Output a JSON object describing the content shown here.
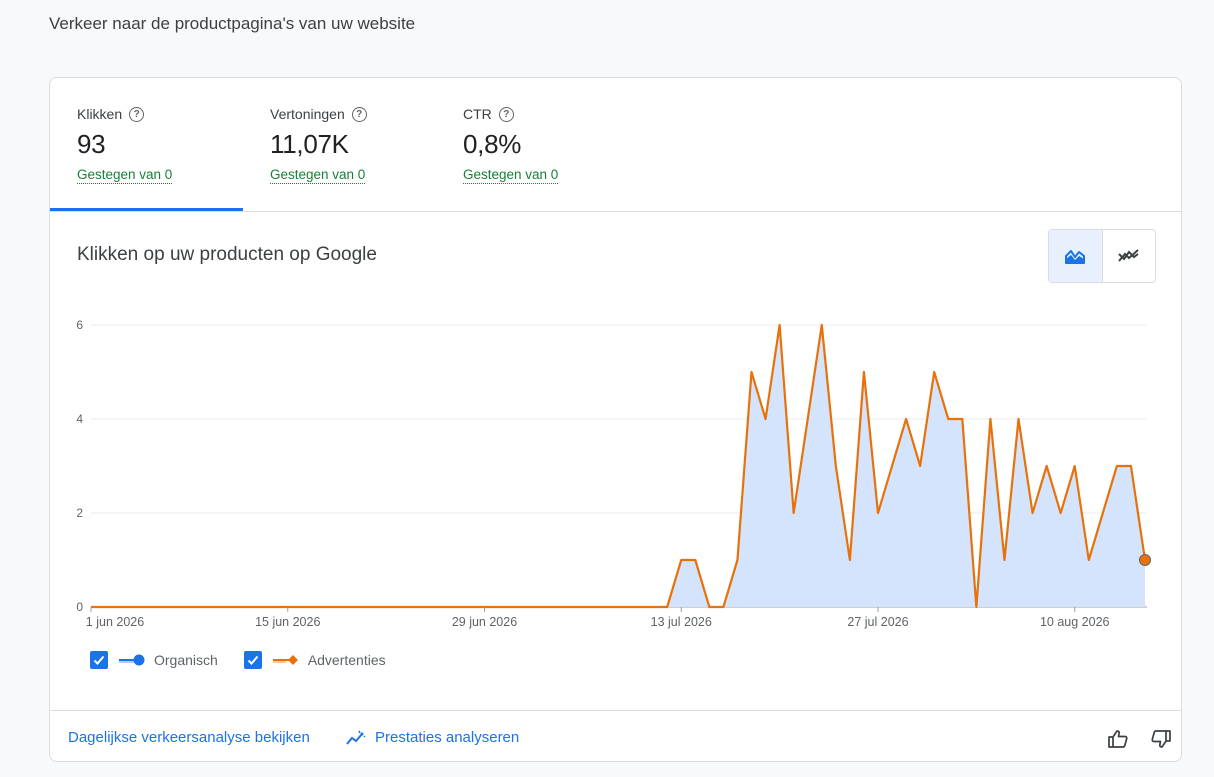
{
  "page_title": "Verkeer naar de productpagina's van uw website",
  "metrics": [
    {
      "label": "Klikken",
      "value": "93",
      "change": "Gestegen van 0"
    },
    {
      "label": "Vertoningen",
      "value": "11,07K",
      "change": "Gestegen van 0"
    },
    {
      "label": "CTR",
      "value": "0,8%",
      "change": "Gestegen van 0"
    }
  ],
  "chart_section_title": "Klikken op uw producten op Google",
  "toggle": {
    "area_icon": "area-chart-icon",
    "trend_icon": "trend-chart-icon"
  },
  "legend": [
    {
      "label": "Organisch",
      "color": "#1a73e8"
    },
    {
      "label": "Advertenties",
      "color": "#e8710a"
    }
  ],
  "footer": {
    "daily_link": "Dagelijkse verkeersanalyse bekijken",
    "analyze_link": "Prestaties analyseren"
  },
  "colors": {
    "accent": "#1a73e8",
    "series_line": "#e8710a",
    "area_fill": "#d2e3fc",
    "positive": "#188038"
  },
  "chart_data": {
    "type": "area",
    "title": "Klikken op uw producten op Google",
    "xlabel": "",
    "ylabel": "",
    "ylim": [
      0,
      6
    ],
    "yticks": [
      0,
      2,
      4,
      6
    ],
    "x_tick_labels": [
      "1 jun 2026",
      "15 jun 2026",
      "29 jun 2026",
      "13 jul 2026",
      "27 jul 2026",
      "10 aug 2026"
    ],
    "x_start": "1 jun 2026",
    "x_end": "17 aug 2026",
    "grid": true,
    "legend_position": "bottom-left",
    "series": [
      {
        "name": "Advertenties",
        "values": [
          0,
          0,
          0,
          0,
          0,
          0,
          0,
          0,
          0,
          0,
          0,
          0,
          0,
          0,
          0,
          0,
          0,
          0,
          0,
          0,
          0,
          0,
          0,
          0,
          0,
          0,
          0,
          0,
          0,
          0,
          0,
          0,
          0,
          0,
          0,
          0,
          0,
          0,
          0,
          0,
          0,
          0,
          1,
          1,
          0,
          0,
          1,
          5,
          4,
          6,
          2,
          4,
          6,
          3,
          1,
          5,
          2,
          3,
          4,
          3,
          5,
          4,
          4,
          0,
          4,
          1,
          4,
          2,
          3,
          2,
          3,
          1,
          2,
          3,
          3,
          1
        ]
      }
    ]
  }
}
